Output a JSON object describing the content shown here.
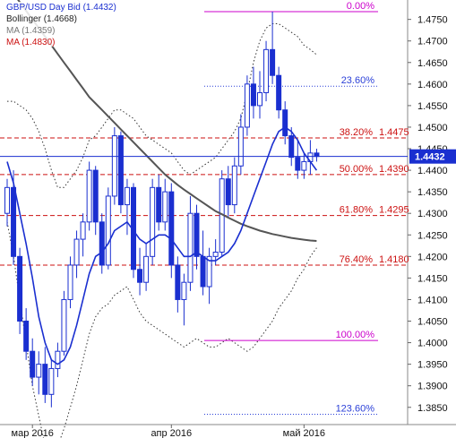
{
  "chart_data": {
    "type": "candlestick",
    "legend": [
      {
        "text": "GBP/USD Day Bid (1.4432)",
        "color": "#1a2fd0"
      },
      {
        "text": "Bollinger (1.4668)",
        "color": "#222222"
      },
      {
        "text": "MA (1.4359)",
        "color": "#777777"
      },
      {
        "text": "MA (1.4830)",
        "color": "#cc1111"
      }
    ],
    "ylim": [
      1.381,
      1.4795
    ],
    "yticks": [
      "1.4750",
      "1.4700",
      "1.4650",
      "1.4600",
      "1.4550",
      "1.4500",
      "1.4450",
      "1.4400",
      "1.4350",
      "1.4300",
      "1.4250",
      "1.4200",
      "1.4150",
      "1.4100",
      "1.4050",
      "1.4000",
      "1.3950",
      "1.3900",
      "1.3850"
    ],
    "ytick_values": [
      1.475,
      1.47,
      1.465,
      1.46,
      1.455,
      1.45,
      1.445,
      1.44,
      1.435,
      1.43,
      1.425,
      1.42,
      1.415,
      1.41,
      1.405,
      1.4,
      1.395,
      1.39,
      1.385
    ],
    "xlabels": [
      {
        "text": "мар 2016",
        "day": 4
      },
      {
        "text": "апр 2016",
        "day": 26
      },
      {
        "text": "май 2016",
        "day": 47
      }
    ],
    "last_price": "1.4432",
    "last_value": 1.4432,
    "fib_levels": [
      {
        "label": "0.00%",
        "value": 1.4768,
        "color": "#cc00cc",
        "style": "solid",
        "price": ""
      },
      {
        "label": "23.60%",
        "value": 1.4595,
        "color": "#2a3fd8",
        "style": "dotted",
        "price": ""
      },
      {
        "label": "38.20%",
        "value": 1.4475,
        "color": "#cc1111",
        "style": "dashed",
        "price": "1.4475"
      },
      {
        "label": "50.00%",
        "value": 1.439,
        "color": "#cc1111",
        "style": "dashed",
        "price": "1.4390"
      },
      {
        "label": "61.80%",
        "value": 1.4295,
        "color": "#cc1111",
        "style": "dashed",
        "price": "1.4295"
      },
      {
        "label": "76.40%",
        "value": 1.418,
        "color": "#cc1111",
        "style": "dashed",
        "price": "1.4180"
      },
      {
        "label": "100.00%",
        "value": 1.4005,
        "color": "#cc00cc",
        "style": "solid",
        "price": ""
      },
      {
        "label": "123.60%",
        "value": 1.3834,
        "color": "#2a3fd8",
        "style": "dotted",
        "price": ""
      }
    ],
    "candles": [
      [
        1.43,
        1.438,
        1.427,
        1.436
      ],
      [
        1.436,
        1.44,
        1.418,
        1.42
      ],
      [
        1.42,
        1.422,
        1.402,
        1.405
      ],
      [
        1.405,
        1.408,
        1.396,
        1.398
      ],
      [
        1.398,
        1.401,
        1.39,
        1.392
      ],
      [
        1.392,
        1.398,
        1.388,
        1.395
      ],
      [
        1.395,
        1.399,
        1.386,
        1.388
      ],
      [
        1.388,
        1.396,
        1.385,
        1.394
      ],
      [
        1.394,
        1.4,
        1.392,
        1.398
      ],
      [
        1.398,
        1.412,
        1.397,
        1.41
      ],
      [
        1.41,
        1.42,
        1.408,
        1.418
      ],
      [
        1.418,
        1.426,
        1.415,
        1.424
      ],
      [
        1.424,
        1.43,
        1.42,
        1.428
      ],
      [
        1.428,
        1.442,
        1.426,
        1.44
      ],
      [
        1.44,
        1.441,
        1.425,
        1.428
      ],
      [
        1.428,
        1.43,
        1.416,
        1.418
      ],
      [
        1.418,
        1.436,
        1.417,
        1.434
      ],
      [
        1.434,
        1.45,
        1.432,
        1.448
      ],
      [
        1.448,
        1.449,
        1.43,
        1.432
      ],
      [
        1.432,
        1.438,
        1.425,
        1.436
      ],
      [
        1.436,
        1.437,
        1.415,
        1.417
      ],
      [
        1.417,
        1.422,
        1.411,
        1.414
      ],
      [
        1.414,
        1.423,
        1.412,
        1.42
      ],
      [
        1.42,
        1.438,
        1.418,
        1.436
      ],
      [
        1.436,
        1.439,
        1.426,
        1.428
      ],
      [
        1.428,
        1.438,
        1.426,
        1.435
      ],
      [
        1.435,
        1.437,
        1.415,
        1.418
      ],
      [
        1.418,
        1.42,
        1.407,
        1.41
      ],
      [
        1.41,
        1.416,
        1.404,
        1.414
      ],
      [
        1.414,
        1.434,
        1.412,
        1.43
      ],
      [
        1.43,
        1.432,
        1.417,
        1.42
      ],
      [
        1.42,
        1.426,
        1.411,
        1.413
      ],
      [
        1.413,
        1.422,
        1.409,
        1.42
      ],
      [
        1.42,
        1.424,
        1.418,
        1.421
      ],
      [
        1.421,
        1.44,
        1.42,
        1.438
      ],
      [
        1.438,
        1.441,
        1.429,
        1.432
      ],
      [
        1.432,
        1.443,
        1.43,
        1.441
      ],
      [
        1.441,
        1.453,
        1.439,
        1.45
      ],
      [
        1.45,
        1.462,
        1.448,
        1.46
      ],
      [
        1.46,
        1.464,
        1.452,
        1.455
      ],
      [
        1.455,
        1.463,
        1.452,
        1.458
      ],
      [
        1.458,
        1.47,
        1.456,
        1.468
      ],
      [
        1.468,
        1.4768,
        1.46,
        1.462
      ],
      [
        1.462,
        1.464,
        1.452,
        1.454
      ],
      [
        1.454,
        1.456,
        1.446,
        1.448
      ],
      [
        1.448,
        1.45,
        1.441,
        1.443
      ],
      [
        1.443,
        1.447,
        1.438,
        1.44
      ],
      [
        1.44,
        1.444,
        1.438,
        1.442
      ],
      [
        1.442,
        1.447,
        1.439,
        1.444
      ],
      [
        1.444,
        1.445,
        1.442,
        1.4432
      ]
    ],
    "ma_fast": [
      1.442,
      1.437,
      1.43,
      1.423,
      1.415,
      1.406,
      1.4,
      1.396,
      1.395,
      1.396,
      1.399,
      1.404,
      1.41,
      1.416,
      1.42,
      1.421,
      1.423,
      1.426,
      1.427,
      1.428,
      1.426,
      1.424,
      1.423,
      1.424,
      1.425,
      1.425,
      1.424,
      1.422,
      1.42,
      1.42,
      1.421,
      1.42,
      1.419,
      1.419,
      1.42,
      1.421,
      1.423,
      1.426,
      1.43,
      1.434,
      1.438,
      1.442,
      1.446,
      1.449,
      1.45,
      1.449,
      1.447,
      1.444,
      1.442,
      1.44
    ],
    "ma_slow": [
      1.483,
      1.481,
      1.479,
      1.477,
      1.475,
      1.473,
      1.471,
      1.469,
      1.467,
      1.465,
      1.463,
      1.461,
      1.459,
      1.457,
      1.4555,
      1.454,
      1.4525,
      1.451,
      1.4495,
      1.448,
      1.4465,
      1.445,
      1.4435,
      1.442,
      1.4405,
      1.439,
      1.4378,
      1.4366,
      1.4355,
      1.4345,
      1.4335,
      1.4325,
      1.4315,
      1.4305,
      1.4298,
      1.429,
      1.4283,
      1.4276,
      1.427,
      1.4265,
      1.426,
      1.4256,
      1.4252,
      1.4249,
      1.4246,
      1.4243,
      1.4241,
      1.4239,
      1.4237,
      1.4236
    ],
    "boll_upper": [
      1.456,
      1.456,
      1.455,
      1.454,
      1.452,
      1.449,
      1.445,
      1.44,
      1.436,
      1.436,
      1.438,
      1.44,
      1.443,
      1.447,
      1.448,
      1.45,
      1.452,
      1.454,
      1.454,
      1.453,
      1.452,
      1.45,
      1.448,
      1.447,
      1.446,
      1.445,
      1.444,
      1.442,
      1.44,
      1.439,
      1.44,
      1.441,
      1.442,
      1.443,
      1.445,
      1.447,
      1.449,
      1.452,
      1.458,
      1.465,
      1.47,
      1.473,
      1.474,
      1.474,
      1.473,
      1.472,
      1.471,
      1.469,
      1.468,
      1.4668
    ],
    "boll_lower": [
      1.428,
      1.42,
      1.41,
      1.4,
      1.39,
      1.383,
      1.376,
      1.374,
      1.376,
      1.38,
      1.385,
      1.39,
      1.396,
      1.402,
      1.406,
      1.408,
      1.409,
      1.411,
      1.412,
      1.413,
      1.41,
      1.407,
      1.405,
      1.404,
      1.403,
      1.402,
      1.401,
      1.4,
      1.399,
      1.4,
      1.401,
      1.4,
      1.399,
      1.399,
      1.4,
      1.401,
      1.4,
      1.399,
      1.398,
      1.399,
      1.401,
      1.403,
      1.405,
      1.408,
      1.41,
      1.412,
      1.415,
      1.417,
      1.42,
      1.422
    ]
  }
}
